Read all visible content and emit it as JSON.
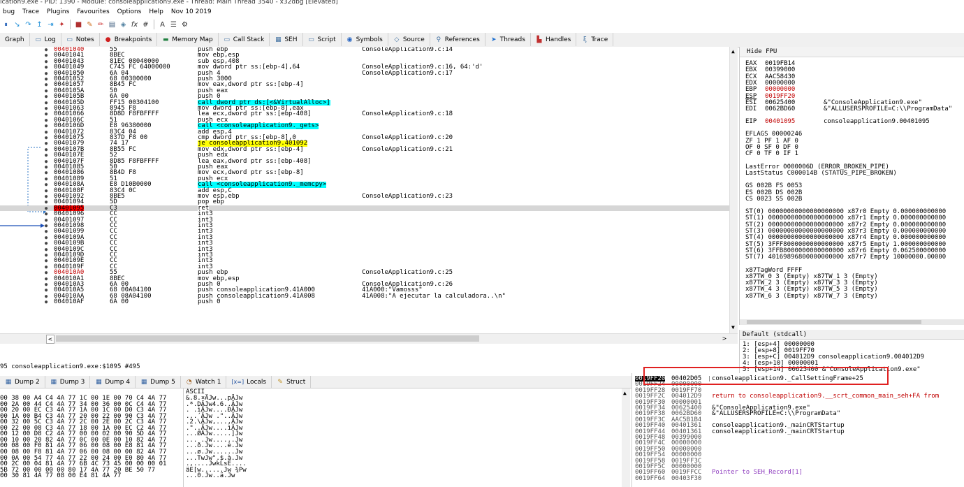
{
  "title_bar": "ication9.exe - PID: 1390 - Module: consoleapplication9.exe - Thread: Main Thread 3540 - x32dbg [Elevated]",
  "menu": [
    "bug",
    "Trace",
    "Plugins",
    "Favourites",
    "Options",
    "Help",
    "Nov 10 2019"
  ],
  "toolbar_icons": [
    "pause-icon",
    "step-into-icon",
    "step-over-icon",
    "step-out-icon",
    "run-to-user-icon",
    "trace-icon",
    "hw-break-icon",
    "patch-icon",
    "pencil-icon",
    "memory-icon",
    "expression-icon",
    "fx-icon",
    "hash-icon",
    "font-icon",
    "list-icon",
    "settings-icon"
  ],
  "toolbar_fx": "fx",
  "toolbar_hash": "#",
  "tabs": [
    {
      "label": "Graph",
      "icon": "graph-icon"
    },
    {
      "label": "Log",
      "icon": "log-icon"
    },
    {
      "label": "Notes",
      "icon": "notes-icon"
    },
    {
      "label": "Breakpoints",
      "icon": "breakpoint-dot-icon"
    },
    {
      "label": "Memory Map",
      "icon": "memory-map-icon"
    },
    {
      "label": "Call Stack",
      "icon": "call-stack-icon"
    },
    {
      "label": "SEH",
      "icon": "seh-icon"
    },
    {
      "label": "Script",
      "icon": "script-icon"
    },
    {
      "label": "Symbols",
      "icon": "symbols-icon"
    },
    {
      "label": "Source",
      "icon": "source-icon"
    },
    {
      "label": "References",
      "icon": "references-icon"
    },
    {
      "label": "Threads",
      "icon": "threads-icon"
    },
    {
      "label": "Handles",
      "icon": "handles-icon"
    },
    {
      "label": "Trace",
      "icon": "trace-icon"
    }
  ],
  "disasm": [
    {
      "addr": "00401040",
      "bytes": "55",
      "instr": "push ebp",
      "cmt": "ConsoleApplication9.c:14",
      "addr_red": true
    },
    {
      "addr": "00401041",
      "bytes": "8BEC",
      "instr": "mov ebp,esp",
      "cmt": ""
    },
    {
      "addr": "00401043",
      "bytes": "81EC 08040000",
      "instr": "sub esp,408",
      "cmt": ""
    },
    {
      "addr": "00401049",
      "bytes": "C745 FC 64000000",
      "instr": "mov dword ptr ss:[ebp-4],64",
      "cmt": "ConsoleApplication9.c:16, 64:'d'"
    },
    {
      "addr": "00401050",
      "bytes": "6A 04",
      "instr": "push 4",
      "cmt": "ConsoleApplication9.c:17"
    },
    {
      "addr": "00401052",
      "bytes": "68 00300000",
      "instr": "push 3000",
      "cmt": ""
    },
    {
      "addr": "00401057",
      "bytes": "8B45 FC",
      "instr": "mov eax,dword ptr ss:[ebp-4]",
      "cmt": ""
    },
    {
      "addr": "0040105A",
      "bytes": "50",
      "instr": "push eax",
      "cmt": ""
    },
    {
      "addr": "0040105B",
      "bytes": "6A 00",
      "instr": "push 0",
      "cmt": ""
    },
    {
      "addr": "0040105D",
      "bytes": "FF15 00304100",
      "instr": "call dword ptr ds:[<&VirtualAlloc>]",
      "cmt": "",
      "kind": "call"
    },
    {
      "addr": "00401063",
      "bytes": "8945 F8",
      "instr": "mov dword ptr ss:[ebp-8],eax",
      "cmt": ""
    },
    {
      "addr": "00401066",
      "bytes": "8D8D F8FBFFFF",
      "instr": "lea ecx,dword ptr ss:[ebp-408]",
      "cmt": "ConsoleApplication9.c:18"
    },
    {
      "addr": "0040106C",
      "bytes": "51",
      "instr": "push ecx",
      "cmt": ""
    },
    {
      "addr": "0040106D",
      "bytes": "E8 96380000",
      "instr": "call <consoleapplication9._gets>",
      "cmt": "",
      "kind": "call"
    },
    {
      "addr": "00401072",
      "bytes": "83C4 04",
      "instr": "add esp,4",
      "cmt": ""
    },
    {
      "addr": "00401075",
      "bytes": "837D F8 00",
      "instr": "cmp dword ptr ss:[ebp-8],0",
      "cmt": "ConsoleApplication9.c:20"
    },
    {
      "addr": "00401079",
      "bytes": "74 17",
      "instr": "je consoleapplication9.401092",
      "cmt": "",
      "kind": "jump"
    },
    {
      "addr": "0040107B",
      "bytes": "8B55 FC",
      "instr": "mov edx,dword ptr ss:[ebp-4]",
      "cmt": "ConsoleApplication9.c:21"
    },
    {
      "addr": "0040107E",
      "bytes": "52",
      "instr": "push edx",
      "cmt": ""
    },
    {
      "addr": "0040107F",
      "bytes": "8D85 F8FBFFFF",
      "instr": "lea eax,dword ptr ss:[ebp-408]",
      "cmt": ""
    },
    {
      "addr": "00401085",
      "bytes": "50",
      "instr": "push eax",
      "cmt": ""
    },
    {
      "addr": "00401086",
      "bytes": "8B4D F8",
      "instr": "mov ecx,dword ptr ss:[ebp-8]",
      "cmt": ""
    },
    {
      "addr": "00401089",
      "bytes": "51",
      "instr": "push ecx",
      "cmt": ""
    },
    {
      "addr": "0040108A",
      "bytes": "E8 D10B0000",
      "instr": "call <consoleapplication9._memcpy>",
      "cmt": "",
      "kind": "call"
    },
    {
      "addr": "0040108F",
      "bytes": "83C4 0C",
      "instr": "add esp,C",
      "cmt": ""
    },
    {
      "addr": "00401092",
      "bytes": "8BE5",
      "instr": "mov esp,ebp",
      "cmt": "ConsoleApplication9.c:23"
    },
    {
      "addr": "00401094",
      "bytes": "5D",
      "instr": "pop ebp",
      "cmt": ""
    },
    {
      "addr": "00401095",
      "bytes": "C3",
      "instr": "ret",
      "cmt": "",
      "kind": "current"
    },
    {
      "addr": "00401096",
      "bytes": "CC",
      "instr": "int3",
      "cmt": ""
    },
    {
      "addr": "00401097",
      "bytes": "CC",
      "instr": "int3",
      "cmt": ""
    },
    {
      "addr": "00401098",
      "bytes": "CC",
      "instr": "int3",
      "cmt": ""
    },
    {
      "addr": "00401099",
      "bytes": "CC",
      "instr": "int3",
      "cmt": ""
    },
    {
      "addr": "0040109A",
      "bytes": "CC",
      "instr": "int3",
      "cmt": ""
    },
    {
      "addr": "0040109B",
      "bytes": "CC",
      "instr": "int3",
      "cmt": ""
    },
    {
      "addr": "0040109C",
      "bytes": "CC",
      "instr": "int3",
      "cmt": ""
    },
    {
      "addr": "0040109D",
      "bytes": "CC",
      "instr": "int3",
      "cmt": ""
    },
    {
      "addr": "0040109E",
      "bytes": "CC",
      "instr": "int3",
      "cmt": ""
    },
    {
      "addr": "0040109F",
      "bytes": "CC",
      "instr": "int3",
      "cmt": ""
    },
    {
      "addr": "004010A0",
      "bytes": "55",
      "instr": "push ebp",
      "cmt": "ConsoleApplication9.c:25",
      "addr_red": true
    },
    {
      "addr": "004010A1",
      "bytes": "8BEC",
      "instr": "mov ebp,esp",
      "cmt": ""
    },
    {
      "addr": "004010A3",
      "bytes": "6A 00",
      "instr": "push 0",
      "cmt": "ConsoleApplication9.c:26"
    },
    {
      "addr": "004010A5",
      "bytes": "68 00A04100",
      "instr": "push consoleapplication9.41A000",
      "cmt": "41A000:\"Vamosss\""
    },
    {
      "addr": "004010AA",
      "bytes": "68 08A04100",
      "instr": "push consoleapplication9.41A008",
      "cmt": "41A008:\"A ejecutar la calculadora..\\n\""
    },
    {
      "addr": "004010AF",
      "bytes": "6A 00",
      "instr": "push 0",
      "cmt": ""
    }
  ],
  "registers": {
    "header": "Hide FPU",
    "general": [
      {
        "name": "EAX",
        "value": "0019FB14",
        "cmt": ""
      },
      {
        "name": "EBX",
        "value": "00399000",
        "cmt": ""
      },
      {
        "name": "ECX",
        "value": "AAC58430",
        "cmt": ""
      },
      {
        "name": "EDX",
        "value": "00000000",
        "cmt": ""
      },
      {
        "name": "EBP",
        "value": "00000000",
        "cmt": "",
        "red": true
      },
      {
        "name": "ESP",
        "value": "0019FF20",
        "cmt": "",
        "red": true
      },
      {
        "name": "ESI",
        "value": "00625400",
        "cmt": "&\"ConsoleApplication9.exe\""
      },
      {
        "name": "EDI",
        "value": "0062BD60",
        "cmt": "&\"ALLUSERSPROFILE=C:\\\\ProgramData\""
      }
    ],
    "eip": {
      "name": "EIP",
      "value": "00401095",
      "cmt": "consoleapplication9.00401095"
    },
    "flags": [
      "EFLAGS   00000246",
      "ZF 1  PF 1  AF 0",
      "OF 0  SF 0  DF 0",
      "CF 0  TF 0  IF 1"
    ],
    "errors": [
      "LastError  0000006D (ERROR_BROKEN_PIPE)",
      "LastStatus C000014B (STATUS_PIPE_BROKEN)"
    ],
    "segments": [
      "GS 002B  FS 0053",
      "ES 002B  DS 002B",
      "CS 0023  SS 002B"
    ],
    "fpu": [
      "ST(0) 00000000000000000000 x87r0 Empty 0.000000000000",
      "ST(1) 00000000000000000000 x87r1 Empty 0.000000000000",
      "ST(2) 00000000000000000000 x87r2 Empty 0.000000000000",
      "ST(3) 00000000000000000000 x87r3 Empty 0.000000000000",
      "ST(4) 00000000000000000000 x87r4 Empty 0.000000000000",
      "ST(5) 3FFF8000000000000000 x87r5 Empty 1.000000000000",
      "ST(6) 3FFB8000000000000000 x87r6 Empty 0.062500000000",
      "ST(7) 40169896800000000000 x87r7 Empty 10000000.00000"
    ],
    "tag": [
      "x87TagWord FFFF",
      "x87TW_0 3 (Empty)    x87TW_1 3 (Empty)",
      "x87TW_2 3 (Empty)    x87TW_3 3 (Empty)",
      "x87TW_4 3 (Empty)    x87TW_5 3 (Empty)",
      "x87TW_6 3 (Empty)    x87TW_7 3 (Empty)"
    ]
  },
  "stdcall": {
    "selector": "Default (stdcall)",
    "rows": [
      "1: [esp+4] 00000000",
      "2: [esp+8] 0019FF70",
      "3: [esp+C] 004012D9 consoleapplication9.004012D9",
      "4: [esp+10] 00000001",
      "5: [esp+14] 00625400 &\"ConsoleApplication9.exe\""
    ]
  },
  "status": "95 consoleapplication9.exe:$1095 #495",
  "dump_tabs": [
    {
      "label": "Dump 2",
      "icon": "dump-icon"
    },
    {
      "label": "Dump 3",
      "icon": "dump-icon"
    },
    {
      "label": "Dump 4",
      "icon": "dump-icon"
    },
    {
      "label": "Dump 5",
      "icon": "dump-icon"
    },
    {
      "label": "Watch 1",
      "icon": "watch-icon"
    },
    {
      "label": "Locals",
      "icon": "locals-icon",
      "prefix": "[x=]"
    },
    {
      "label": "Struct",
      "icon": "struct-icon"
    }
  ],
  "dump": {
    "ascii_header": "ASCII",
    "rows": [
      {
        "hex": "00 38 00 A4 C4 4A 77 1C 00 1E 00 70 C4 4A 77",
        "ascii": "&.8.¤ÄJw...pÄJw"
      },
      {
        "hex": "00 2A 00 44 C4 4A 77 34 00 36 00 0C C4 4A 77",
        "ascii": ".*.DÄJw4.6..ÄJw"
      },
      {
        "hex": "00 20 00 EC C3 4A 77 1A 00 1C 00 D0 C3 4A 77",
        "ascii": ". .ìÃJw....ÐÃJw"
      },
      {
        "hex": "00 1A 00 B4 C3 4A 77 20 00 22 00 90 C3 4A 77",
        "ascii": "...´ÃJw .\"..ÃJw"
      },
      {
        "hex": "00 32 00 5C C3 4A 77 2C 00 2E 00 2C C3 4A 77",
        "ascii": ".2.\\ÃJw,...,ÃJw"
      },
      {
        "hex": "00 22 00 08 C3 4A 77 18 00 1A 00 EC C2 4A 77",
        "ascii": ".\"..ÃJw....ìÂJw"
      },
      {
        "hex": "00 12 00 D8 C2 4A 77 00 00 02 00 90 5D 4A 77",
        "ascii": "...ØÂJw.....]Jw"
      },
      {
        "hex": "00 10 00 20 82 4A 77 0C 00 0E 00 10 82 4A 77",
        "ascii": "... .Jw......Jw"
      },
      {
        "hex": "00 08 00 F0 81 4A 77 06 00 08 00 E8 81 4A 77",
        "ascii": "...ð.Jw....è.Jw"
      },
      {
        "hex": "00 08 00 F8 81 4A 77 06 00 08 00 00 82 4A 77",
        "ascii": "...ø.Jw......Jw"
      },
      {
        "hex": "00 0A 00 54 77 4A 77 22 00 24 00 E0 80 4A 77",
        "ascii": "...TwJw\".$.à.Jw"
      },
      {
        "hex": "00 2C 00 04 81 4A 77 6B 4C 73 45 00 00 00 01",
        "ascii": ".,....JwkLsE...."
      },
      {
        "hex": "5B 72 00 00 00 00 80 17 4A 77 20 BE 50 77",
        "ascii": "äE[w......Jw ¾Pw"
      },
      {
        "hex": "00 30 81 4A 77 08 00 E4 81 4A 77",
        "ascii": "...0.Jw..ä.Jw"
      }
    ]
  },
  "stack": {
    "rows": [
      {
        "addr": "0019FF20",
        "val": "00402D05",
        "cmt": "consoleapplication9._CallSettingFrame+25",
        "current": true
      },
      {
        "addr": "0019FF24",
        "val": "00000000",
        "cmt": ""
      },
      {
        "addr": "0019FF28",
        "val": "0019FF70",
        "cmt": ""
      },
      {
        "addr": "0019FF2C",
        "val": "004012D9",
        "cmt": "return to consoleapplication9.__scrt_common_main_seh+FA from",
        "red": true
      },
      {
        "addr": "0019FF30",
        "val": "00000001",
        "cmt": ""
      },
      {
        "addr": "0019FF34",
        "val": "00625400",
        "cmt": "&\"ConsoleApplication9.exe\""
      },
      {
        "addr": "0019FF38",
        "val": "0062BD60",
        "cmt": "&\"ALLUSERSPROFILE=C:\\\\ProgramData\""
      },
      {
        "addr": "0019FF3C",
        "val": "AAC5B1B4",
        "cmt": ""
      },
      {
        "addr": "0019FF40",
        "val": "00401361",
        "cmt": "consoleapplication9._mainCRTStartup"
      },
      {
        "addr": "0019FF44",
        "val": "00401361",
        "cmt": "consoleapplication9._mainCRTStartup"
      },
      {
        "addr": "0019FF48",
        "val": "00399000",
        "cmt": ""
      },
      {
        "addr": "0019FF4C",
        "val": "00000000",
        "cmt": ""
      },
      {
        "addr": "0019FF50",
        "val": "00000000",
        "cmt": ""
      },
      {
        "addr": "0019FF54",
        "val": "00000000",
        "cmt": ""
      },
      {
        "addr": "0019FF58",
        "val": "0019FF3C",
        "cmt": ""
      },
      {
        "addr": "0019FF5C",
        "val": "00000000",
        "cmt": ""
      },
      {
        "addr": "0019FF60",
        "val": "0019FFCC",
        "cmt": "Pointer to SEH_Record[1]",
        "purple": true
      },
      {
        "addr": "0019FF64",
        "val": "00403F30",
        "cmt": ""
      }
    ]
  },
  "colors": {
    "accent_cyan": "#00ffff",
    "accent_yellow": "#ffff00",
    "current_red": "#ff0000",
    "highlight_box": "#e02020"
  }
}
